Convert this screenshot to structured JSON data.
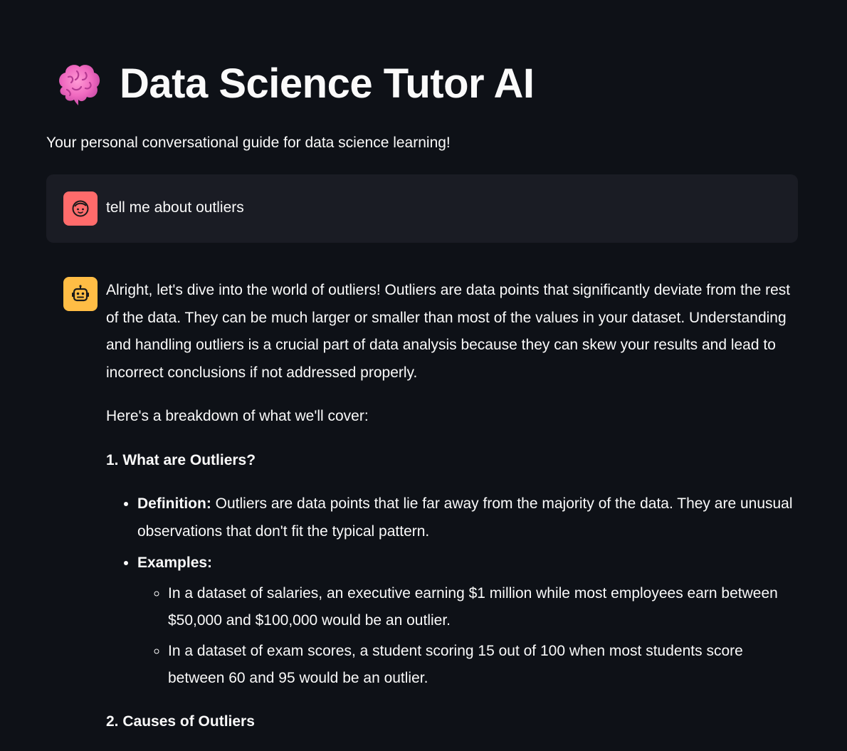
{
  "header": {
    "icon": "brain-icon",
    "title": "Data Science Tutor AI",
    "subtitle": "Your personal conversational guide for data science learning!"
  },
  "colors": {
    "background": "#0e1117",
    "user_bubble": "#1a1c24",
    "user_avatar": "#ff6b6b",
    "assistant_avatar": "#ffbd45",
    "text": "#fafafa"
  },
  "messages": {
    "user": {
      "avatar_icon": "user-face-icon",
      "text": "tell me about outliers"
    },
    "assistant": {
      "avatar_icon": "robot-icon",
      "intro": "Alright, let's dive into the world of outliers! Outliers are data points that significantly deviate from the rest of the data. They can be much larger or smaller than most of the values in your dataset. Understanding and handling outliers is a crucial part of data analysis because they can skew your results and lead to incorrect conclusions if not addressed properly.",
      "breakdown": "Here's a breakdown of what we'll cover:",
      "section1": {
        "heading": "1. What are Outliers?",
        "definition_label": "Definition:",
        "definition_text": " Outliers are data points that lie far away from the majority of the data. They are unusual observations that don't fit the typical pattern.",
        "examples_label": "Examples:",
        "examples": [
          "In a dataset of salaries, an executive earning $1 million while most employees earn between $50,000 and $100,000 would be an outlier.",
          "In a dataset of exam scores, a student scoring 15 out of 100 when most students score between 60 and 95 would be an outlier."
        ]
      },
      "section2": {
        "heading": "2. Causes of Outliers"
      }
    }
  }
}
